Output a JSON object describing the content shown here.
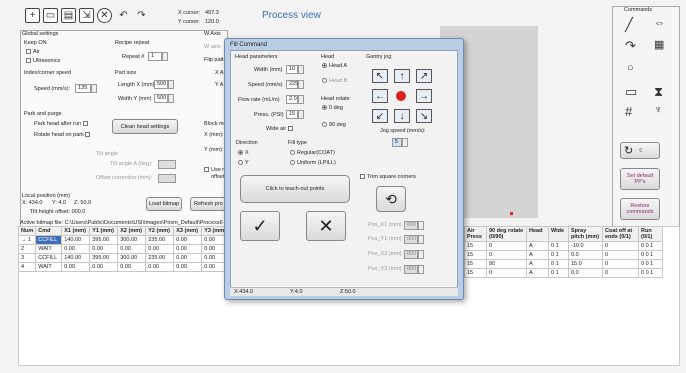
{
  "toolbar": {
    "icons": [
      "plus-icon",
      "new-icon",
      "save-icon",
      "export-icon",
      "delete-icon",
      "undo-icon",
      "redo-icon"
    ],
    "cursor_x_label": "X cursor:",
    "cursor_x": "497.3",
    "cursor_y_label": "Y cursor:",
    "cursor_y": "120.0",
    "view_title": "Process view"
  },
  "global": {
    "header": "Global settings",
    "keep_on": "Keep ON",
    "air": "Air",
    "ultrasonics": "Ultrasonics",
    "index_speed_label": "Index/corner speed",
    "speed_label": "Speed (mm/s):",
    "speed_value": "135",
    "recipe_repeat": "Recipe repeat",
    "repeat_label": "Repeat #",
    "repeat_value": "1",
    "part_size": "Part size",
    "length_label": "Length X (mm)",
    "length_value": "500",
    "width_label": "Width Y (mm)",
    "width_value": "500",
    "park_purge": "Park and purge",
    "park_head": "Park head after run",
    "rotate_head": "Rotate head on park",
    "clean_head": "Clean head settings",
    "tilt_angle": "Tilt angle",
    "tilt_angle_deg": "Tilt angle A (deg):",
    "offset_correction": "Offset correction (mm):",
    "w_axis": "W Axis",
    "w_axis2": "W axis",
    "flip_pattern": "Flip patte",
    "x_a": "X A",
    "y_a": "Y A",
    "block_mo": "Block mo",
    "x_mm": "X (mm):",
    "y_mm": "Y (mm):",
    "use_m": "Use m",
    "offset": "offset",
    "local_position": "Local position (mm)",
    "local_x": "X: 434.0",
    "local_y": "Y: 4.0",
    "local_z": "Z: 50.0",
    "tilt_head_offset": "Tilt height offset: 000.0",
    "load_bitmap": "Load bitmap",
    "refresh_pro": "Refresh pro",
    "bitmap_file": "Active bitmap file: C:\\Users\\Public\\Documents\\USI\\Images\\Prism_Default\\Process6"
  },
  "dialog": {
    "title": "Fill Command",
    "head_params": "Head parameters",
    "width_label": "Width (mm)",
    "width_value": "10",
    "speed_label": "Speed (mm/s)",
    "speed_value": "225",
    "flow_label": "Flow rate (mL/m)",
    "flow_value": "2.0",
    "press_label": "Press. (PSI)",
    "press_value": "15",
    "wide_air": "Wide air",
    "head_label": "Head",
    "head_a": "Head A",
    "head_b": "Head B",
    "head_rotate": "Head rotate",
    "deg0": "0 deg",
    "deg90": "90 deg",
    "direction": "Direction",
    "dir_x": "X",
    "dir_y": "Y",
    "fill_type": "Fill type",
    "regular": "Regular(COAT)",
    "uniform": "Uniform (LPILL)",
    "gantry_jog": "Gantry jog",
    "jog_speed": "Jog speed (mm/s):",
    "jog_speed_value": "5",
    "teach_button": "Click to teach-out points",
    "trim_corners": "Trim square corners",
    "pos_x1": "Pos_X1 (mm)",
    "pos_y1": "Pos_Y1 (mm)",
    "pos_x2": "Pos_X2 (mm)",
    "pos_y2": "Pos_Y2 (mm)",
    "pos_value": "000",
    "status_x": "X:434.0",
    "status_y": "Y:4.0",
    "status_z": "Z:50.0"
  },
  "commands": {
    "title": "Commands",
    "icons": [
      "line-icon",
      "move-icon",
      "arc-icon",
      "grid-icon",
      "circle-icon",
      "rectangle-icon",
      "hourglass-icon",
      "hatch-icon",
      "spray-icon"
    ],
    "repeat_btn": "6",
    "set_default": "Set default PP's",
    "restore": "Restore commands"
  },
  "table": {
    "left_headers": [
      "Num",
      "Cmd",
      "X1 (mm)",
      "Y1 (mm)",
      "X2 (mm)",
      "Y2 (mm)",
      "X3 (mm)",
      "Y3 (mm)"
    ],
    "right_headers": [
      "Air Press",
      "90 deg rotate (0/90)",
      "Head",
      "Wide",
      "Spray pitch (mm)",
      "Coat off at ends (0/1)",
      "Run (0/1)"
    ],
    "rows": [
      {
        "num": "→ 1",
        "cmd": "CCFILL",
        "x1": "140.00",
        "y1": "395.00",
        "x2": "300.00",
        "y2": "235.00",
        "x3": "0.00",
        "y3": "0.00",
        "air": "15",
        "rot": "0",
        "head": "A",
        "wide": "0 1",
        "pitch": "-10.0",
        "coat": "0",
        "run": "0 0 1"
      },
      {
        "num": "2",
        "cmd": "WAIT",
        "x1": "0.00",
        "y1": "0.00",
        "x2": "0.00",
        "y2": "0.00",
        "x3": "0.00",
        "y3": "0.00",
        "air": "15",
        "rot": "0",
        "head": "A",
        "wide": "0 1",
        "pitch": "0.0",
        "coat": "0",
        "run": "0 0 1"
      },
      {
        "num": "3",
        "cmd": "CCFILL",
        "x1": "140.00",
        "y1": "395.00",
        "x2": "300.00",
        "y2": "235.00",
        "x3": "0.00",
        "y3": "0.00",
        "air": "15",
        "rot": "90",
        "head": "A",
        "wide": "0 1",
        "pitch": "15.0",
        "coat": "0",
        "run": "0 0 1"
      },
      {
        "num": "4",
        "cmd": "WAIT",
        "x1": "0.00",
        "y1": "0.00",
        "x2": "0.00",
        "y2": "0.00",
        "x3": "0.00",
        "y3": "0.00",
        "air": "15",
        "rot": "0",
        "head": "A",
        "wide": "0 1",
        "pitch": "0.0",
        "coat": "0",
        "run": "0 0 1"
      }
    ]
  }
}
